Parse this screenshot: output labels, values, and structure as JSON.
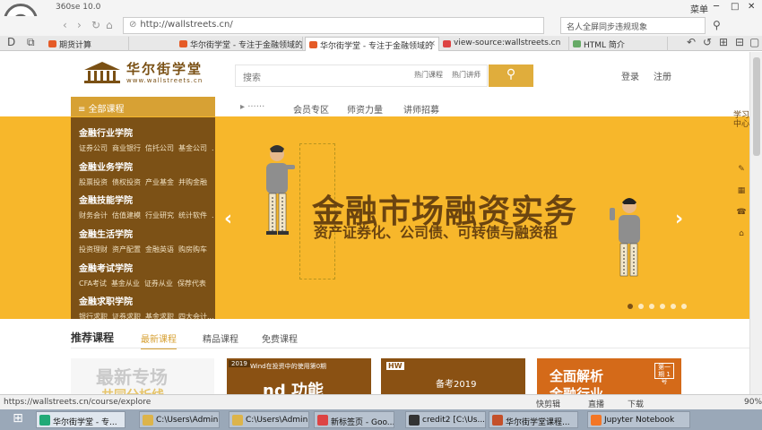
{
  "browser": {
    "version": "360se 10.0",
    "window_controls": {
      "menu": "菜单",
      "minimize": "─",
      "maximize": "□",
      "close": "✕"
    },
    "url": "http://wallstreets.cn/",
    "search_placeholder": "名人全屏同步违规现象",
    "tabs": [
      {
        "label": "期货计算",
        "icon_color": "#e55b27"
      },
      {
        "label": "华尔街学堂 - 专注于金融领域的",
        "icon_color": "#e55b27"
      },
      {
        "label": "华尔街学堂 - 专注于金融领域的",
        "icon_color": "#e55b27",
        "active": true
      },
      {
        "label": "view-source:wallstreets.cn",
        "icon_color": "#d44"
      },
      {
        "label": "HTML 简介",
        "icon_color": "#6a6"
      }
    ]
  },
  "site": {
    "logo_text": "华尔街学堂",
    "logo_url": "www.wallstreets.cn",
    "search_placeholder": "搜索",
    "hot_words": [
      "热门课程",
      "热门讲师"
    ],
    "search_icon": "search-icon",
    "login": "登录",
    "register": "注册",
    "all_courses": "全部课程",
    "nav": [
      "会员专区",
      "师资力量",
      "讲师招募"
    ],
    "categories": [
      {
        "title": "金融行业学院",
        "subs": [
          "证券公司",
          "商业银行",
          "信托公司",
          "基金公司",
          "..."
        ]
      },
      {
        "title": "金融业务学院",
        "subs": [
          "股票投资",
          "债权投资",
          "产业基金",
          "并购金融"
        ]
      },
      {
        "title": "金融技能学院",
        "subs": [
          "财务会计",
          "估值建模",
          "行业研究",
          "统计软件",
          "..."
        ]
      },
      {
        "title": "金融生活学院",
        "subs": [
          "投资理财",
          "资产配置",
          "金融英语",
          "购房购车"
        ]
      },
      {
        "title": "金融考试学院",
        "subs": [
          "CFA考试",
          "基金从业",
          "证券从业",
          "保荐代表"
        ]
      },
      {
        "title": "金融求职学院",
        "subs": [
          "银行求职",
          "证券求职",
          "基金求职",
          "四大会计..."
        ]
      }
    ],
    "banner": {
      "title": "金融市场融资实务",
      "subtitle": "资产证券化、公司债、可转债与融资租",
      "prev": "‹",
      "next": "›",
      "dots": 6,
      "active_dot": 0
    },
    "recommend": {
      "title": "推荐课程",
      "tabs": [
        "最新课程",
        "精品课程",
        "免费课程"
      ]
    },
    "cards": {
      "card1_line1": "最新专场",
      "card1_line2": "共同分析线",
      "card2_tag": "2019",
      "card2_text": "Wind在投资中的使用第0期",
      "card2_big": "nd 功能",
      "card3_tag": "HW",
      "card3_text": "备考2019",
      "card4_line1": "全面解析",
      "card4_line2": "金融行业",
      "card4_badge": "第一期 1号"
    },
    "right_side": [
      "学习中心",
      "✎",
      "▦",
      "☎",
      "⌂"
    ]
  },
  "status": {
    "url": "https://wallstreets.cn/course/explore",
    "items": [
      "快剪辑",
      "直播",
      "下载",
      "90%"
    ]
  },
  "taskbar": {
    "items": [
      {
        "label": "华尔街学堂 - 专...",
        "icon_color": "#2a7",
        "active": true
      },
      {
        "label": "C:\\Users\\Admin...",
        "icon_color": "#ddb44a"
      },
      {
        "label": "C:\\Users\\Admin...",
        "icon_color": "#ddb44a"
      },
      {
        "label": "新标签页 - Goo...",
        "icon_color": "#d44"
      },
      {
        "label": "credit2 [C:\\Us...",
        "icon_color": "#333"
      },
      {
        "label": "华尔街学堂课程...",
        "icon_color": "#c4502a"
      },
      {
        "label": "Jupyter Notebook",
        "icon_color": "#f37626"
      }
    ]
  }
}
